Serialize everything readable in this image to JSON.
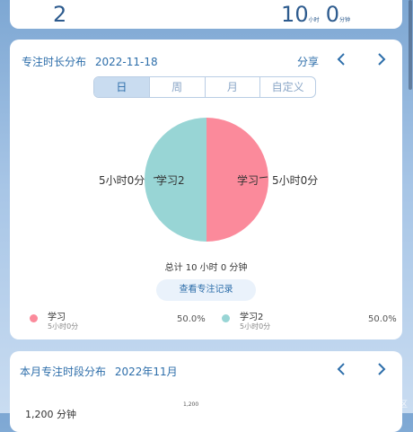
{
  "top": {
    "left_value": "2",
    "hours_value": "10",
    "hours_unit": "小时",
    "minutes_value": "0",
    "minutes_unit": "分钟"
  },
  "focus_card": {
    "title": "专注时长分布",
    "date": "2022-11-18",
    "share_label": "分享",
    "tabs": [
      {
        "label": "日",
        "active": true
      },
      {
        "label": "周",
        "active": false
      },
      {
        "label": "月",
        "active": false
      },
      {
        "label": "自定义",
        "active": false
      }
    ],
    "total_text": "总计 10 小时 0 分钟",
    "view_records_label": "查看专注记录"
  },
  "chart_data": {
    "type": "pie",
    "slices": [
      {
        "name": "学习",
        "value_text": "5小时0分",
        "percent": 50.0,
        "color": "#fb8a9b"
      },
      {
        "name": "学习2",
        "value_text": "5小时0分",
        "percent": 50.0,
        "color": "#98d5d5"
      }
    ],
    "legend": [
      {
        "name": "学习",
        "sub": "5小时0分",
        "percent_text": "50.0%",
        "color": "#fb8a9b"
      },
      {
        "name": "学习2",
        "sub": "5小时0分",
        "percent_text": "50.0%",
        "color": "#98d5d5"
      }
    ]
  },
  "month_card": {
    "title": "本月专注时段分布",
    "month": "2022年11月",
    "ylabel": "1,200 分钟",
    "tick_top": "1,200"
  },
  "watermark": "@稀土掘金技术社区"
}
